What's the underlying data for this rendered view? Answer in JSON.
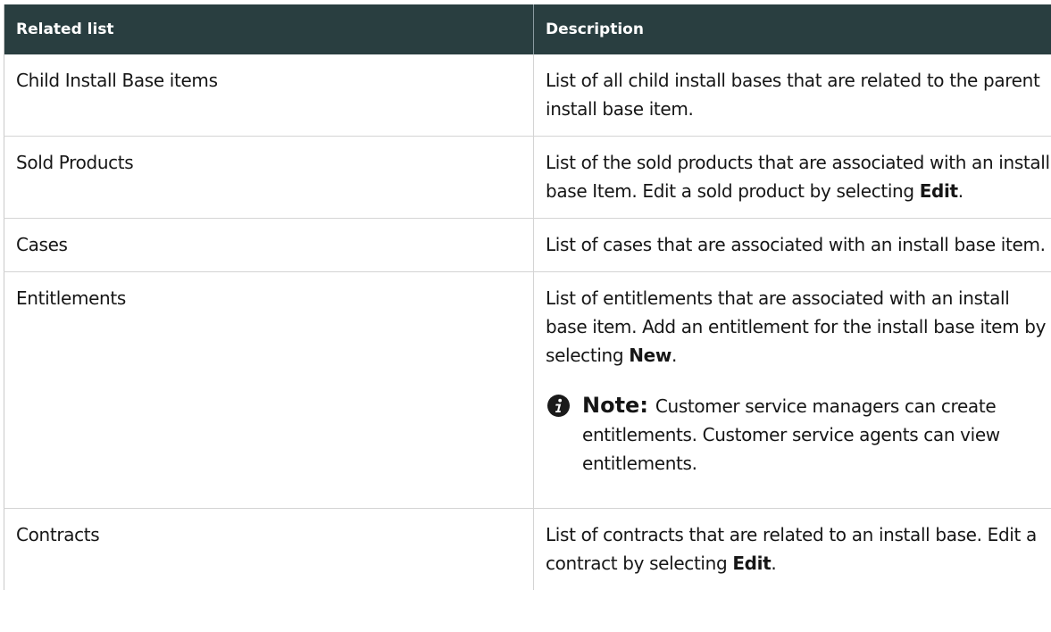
{
  "table": {
    "headers": [
      "Related list",
      "Description"
    ],
    "rows": [
      {
        "name": "Child Install Base items",
        "desc": "List of all child install bases that are related to the parent install base item."
      },
      {
        "name": "Sold Products",
        "desc_before": "List of the sold products that are associated with an install base Item. Edit a sold product by selecting ",
        "desc_bold": "Edit",
        "desc_after": "."
      },
      {
        "name": "Cases",
        "desc": "List of cases that are associated with an install base item."
      },
      {
        "name": "Entitlements",
        "desc_before": "List of entitlements that are associated with an install base item. Add an entitlement for the install base item by selecting ",
        "desc_bold": "New",
        "desc_after": ".",
        "note_label": "Note:",
        "note_text": "Customer service managers can create entitlements. Customer service agents can view entitlements."
      },
      {
        "name": "Contracts",
        "desc_before": "List of contracts that are related to an install base. Edit a contract by selecting ",
        "desc_bold": "Edit",
        "desc_after": "."
      }
    ]
  }
}
